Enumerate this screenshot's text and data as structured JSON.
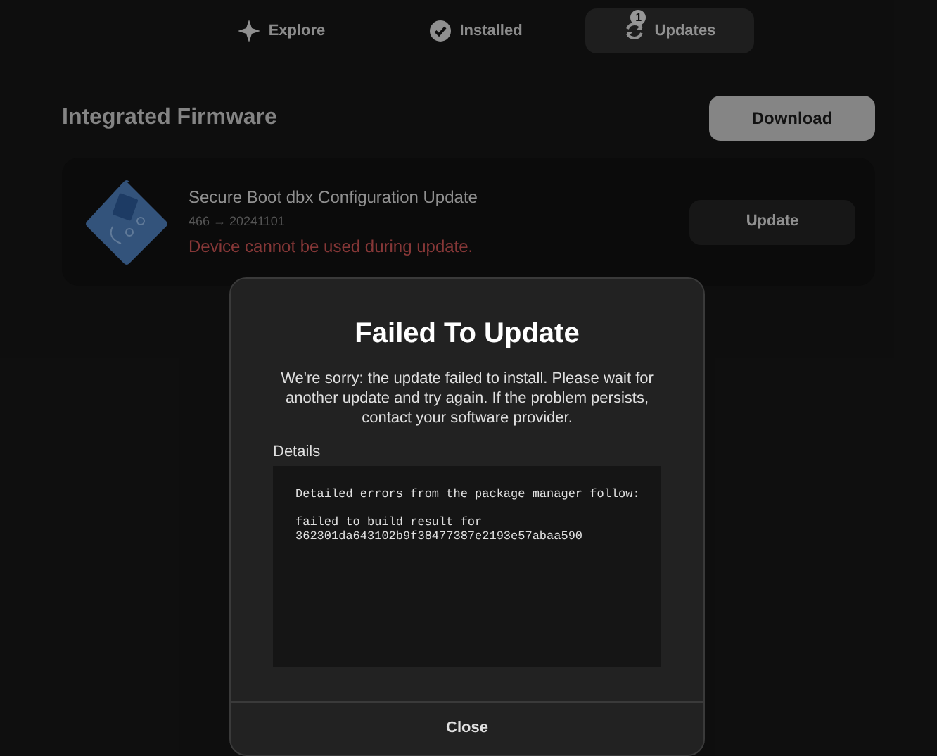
{
  "tabs": [
    {
      "label": "Explore",
      "selected": false
    },
    {
      "label": "Installed",
      "selected": false
    },
    {
      "label": "Updates",
      "selected": true,
      "badge": "1"
    }
  ],
  "section": {
    "title": "Integrated Firmware",
    "action": "Download"
  },
  "firmware": [
    {
      "name": "Secure Boot dbx Configuration Update",
      "from": "466",
      "arrow": "→",
      "to": "20241101",
      "warning": "Device cannot be used during update.",
      "button": "Update"
    }
  ],
  "dialog": {
    "title": "Failed To Update",
    "message": "We're sorry: the update failed to install. Please wait for another update and try again. If the problem persists, contact your software provider.",
    "details_label": "Details",
    "details_blocks": [
      [
        "Detailed errors from the package manager follow:"
      ],
      [
        "failed to build result for",
        "362301da643102b9f38477387e2193e57abaa590"
      ]
    ],
    "button": "Close"
  }
}
